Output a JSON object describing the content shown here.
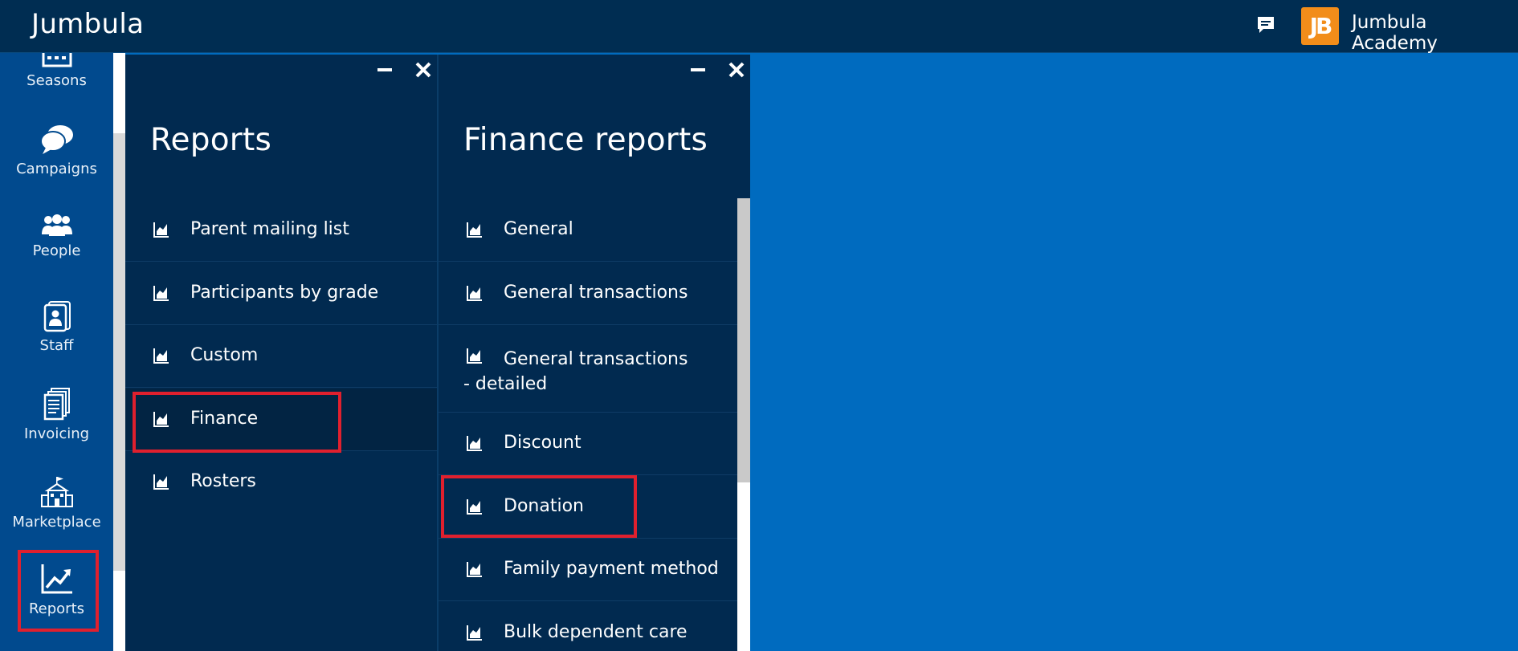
{
  "header": {
    "brand": "Jumbula",
    "account_initials": "JB",
    "account_name": "Jumbula Academy",
    "chat_icon": "chat-bubble-icon"
  },
  "sidebar": {
    "items": [
      {
        "label": "Seasons",
        "icon": "calendar-grid-icon"
      },
      {
        "label": "Campaigns",
        "icon": "speech-bubbles-icon"
      },
      {
        "label": "People",
        "icon": "people-group-icon"
      },
      {
        "label": "Staff",
        "icon": "id-badge-icon"
      },
      {
        "label": "Invoicing",
        "icon": "documents-stack-icon"
      },
      {
        "label": "Marketplace",
        "icon": "schoolhouse-icon"
      },
      {
        "label": "Reports",
        "icon": "line-chart-icon"
      }
    ],
    "active": "Reports"
  },
  "reports_panel": {
    "title": "Reports",
    "items": [
      {
        "label": "Parent mailing list"
      },
      {
        "label": "Participants by grade"
      },
      {
        "label": "Custom"
      },
      {
        "label": "Finance"
      },
      {
        "label": "Rosters"
      }
    ],
    "selected": "Finance"
  },
  "finance_panel": {
    "title": "Finance reports",
    "items": [
      {
        "label": "General"
      },
      {
        "label": "General transactions"
      },
      {
        "label": "General transactions - detailed"
      },
      {
        "label": "Discount"
      },
      {
        "label": "Donation"
      },
      {
        "label": "Family payment method"
      },
      {
        "label": "Bulk dependent care"
      }
    ],
    "highlighted": "Donation"
  },
  "colors": {
    "topbar": "#002d52",
    "sidebar": "#014a8e",
    "panel": "#012a50",
    "workspace": "#006bbf",
    "avatar": "#f28d1a",
    "highlight": "#e0202e"
  }
}
